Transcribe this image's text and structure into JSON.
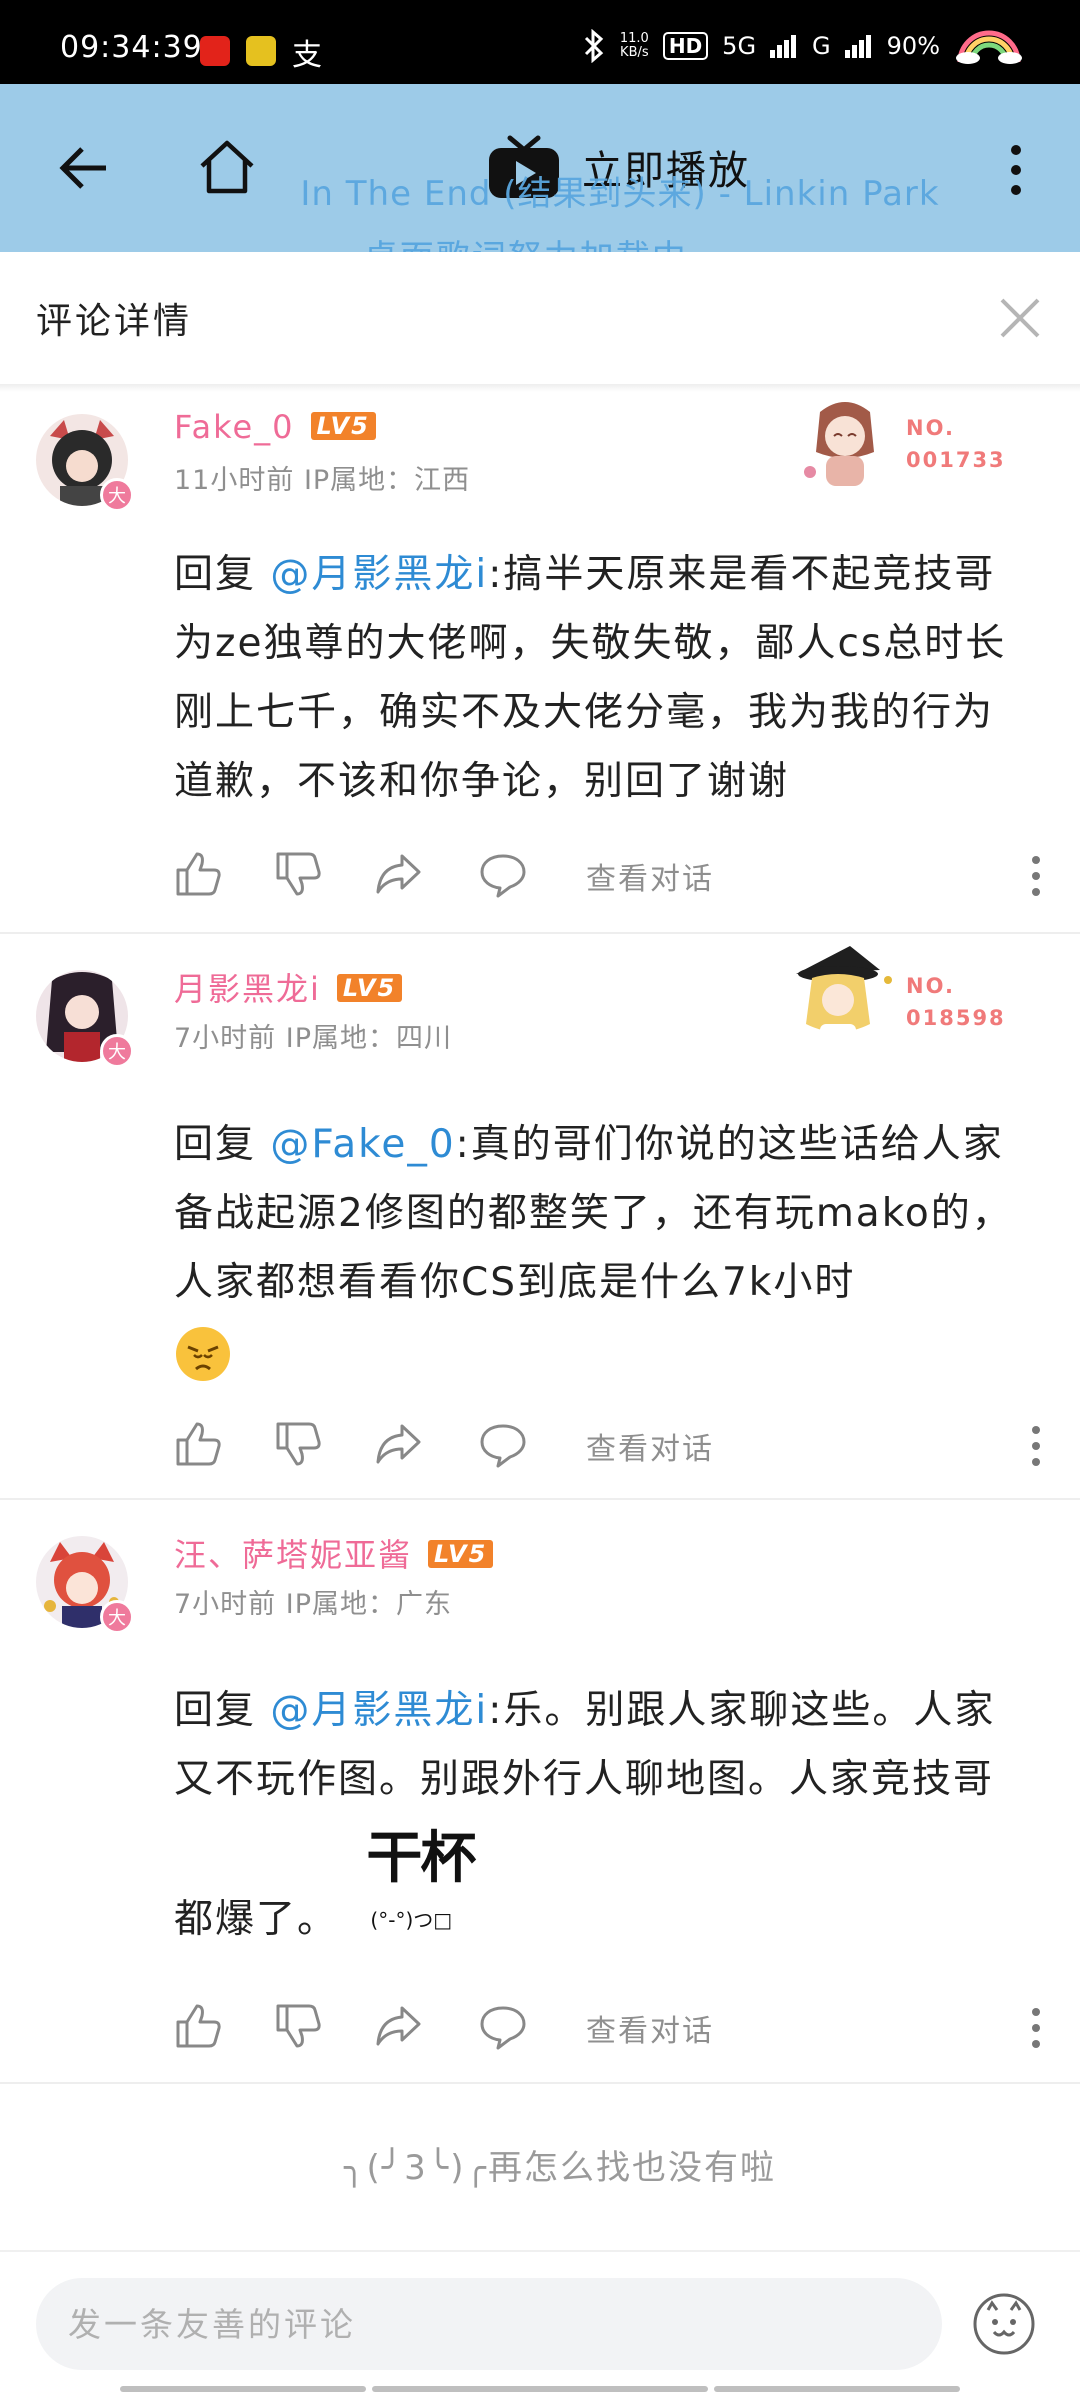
{
  "status_bar": {
    "time": "09:34:39",
    "net_speed_top": "11.0",
    "net_speed_bottom": "KB/s",
    "hd": "HD",
    "sim1": "5G",
    "sim2": "G",
    "battery": "90%"
  },
  "topnav": {
    "play_label": "立即播放",
    "lyric_line1": "In The End (结果到头来) - Linkin Park",
    "lyric_line2": "桌面歌词努力加载中..."
  },
  "header": {
    "title": "评论详情"
  },
  "comments": [
    {
      "username": "Fake_0",
      "level": "LV5",
      "meta": "11小时前  IP属地：江西",
      "fan_no_label": "NO.",
      "fan_no": "001733",
      "mention": "@月影黑龙i",
      "reply_prefix": "回复 ",
      "text": ":搞半天原来是看不起竞技哥为ze独尊的大佬啊，失敬失敬，鄙人cs总时长刚上七千，确实不及大佬分毫，我为我的行为道歉，不该和你争论，别回了谢谢",
      "view_conversation": "查看对话"
    },
    {
      "username": "月影黑龙i",
      "level": "LV5",
      "meta": "7小时前  IP属地：四川",
      "fan_no_label": "NO.",
      "fan_no": "018598",
      "mention": "@Fake_0",
      "reply_prefix": "回复 ",
      "text": ":真的哥们你说的这些话给人家备战起源2修图的都整笑了，还有玩mako的，人家都想看看你CS到底是什么7k小时",
      "view_conversation": "查看对话"
    },
    {
      "username": "汪、萨塔妮亚酱",
      "level": "LV5",
      "meta": "7小时前  IP属地：广东",
      "mention": "@月影黑龙i",
      "reply_prefix": "回复 ",
      "text": ":乐。别跟人家聊这些。人家又不玩作图。别跟外行人聊地图。人家竞技哥都爆了。",
      "sticker_text": "干杯",
      "sticker_sub": "(°-°)つ□",
      "view_conversation": "查看对话"
    }
  ],
  "end_note": "╮(╯3╰)╭再怎么找也没有啦",
  "input": {
    "placeholder": "发一条友善的评论"
  },
  "colors": {
    "nav_bg": "#9dcbe8",
    "username": "#ef6b97",
    "mention": "#2e8bd4",
    "level_badge": "#f2822a",
    "lyric": "#5aa7df"
  }
}
